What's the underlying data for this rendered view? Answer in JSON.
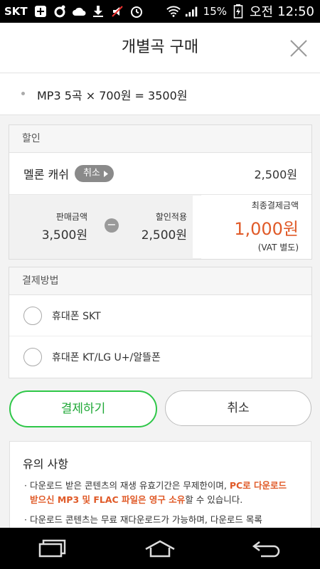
{
  "status_bar": {
    "carrier": "SKT",
    "battery": "15%",
    "ampm": "오전",
    "time": "12:50",
    "icons": [
      "add-icon",
      "sync-icon",
      "cloud-icon",
      "download-icon",
      "mute-icon",
      "alarm-icon",
      "wifi-icon",
      "signal-icon",
      "battery-charging-icon"
    ]
  },
  "header": {
    "title": "개별곡 구매",
    "close_icon": "close-icon"
  },
  "summary": {
    "text": "MP3 5곡 × 700원 = 3500원"
  },
  "discount": {
    "heading": "할인",
    "melon_cash_label": "멜론 캐쉬",
    "cancel_pill": "취소",
    "melon_cash_amount": "2,500원",
    "sale_label": "판매금액",
    "sale_amount": "3,500원",
    "applied_label": "할인적용",
    "applied_amount": "2,500원",
    "final_label": "최종결제금액",
    "final_amount": "1,000원",
    "vat_note": "(VAT 별도)"
  },
  "payment": {
    "heading": "결제방법",
    "options": [
      "휴대폰 SKT",
      "휴대폰 KT/LG U+/알뜰폰"
    ]
  },
  "buttons": {
    "pay": "결제하기",
    "cancel": "취소"
  },
  "notice": {
    "title": "유의 사항",
    "item1_a": "다운로드 받은 콘텐츠의 재생 유효기간은 무제한이며, ",
    "item1_hl": "PC로 다운로드 받으신 MP3 및 FLAC 파일은 영구 소유",
    "item1_b": "할 수 있습니다.",
    "item2": "다운로드 콘텐츠는 무료 재다운로드가 가능하며, 다운로드 목록"
  },
  "colors": {
    "accent_green": "#2ec748",
    "price_orange": "#e05a28"
  }
}
